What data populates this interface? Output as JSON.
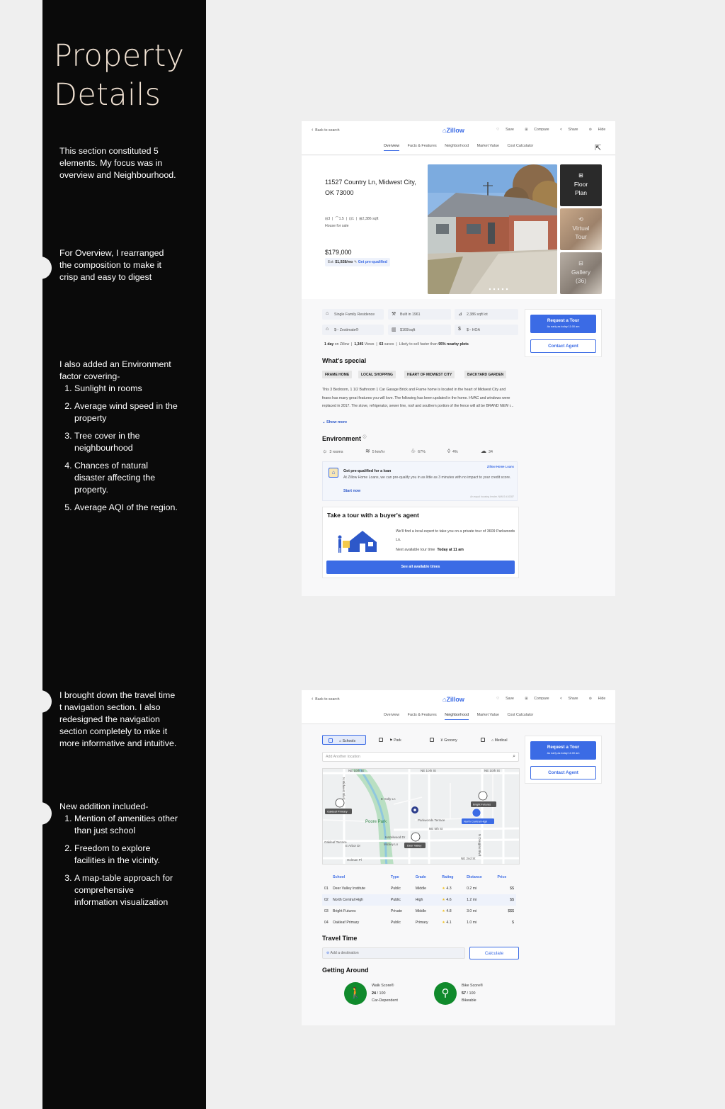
{
  "sidebar": {
    "title": "Property Details",
    "note1": "This section constituted 5 elements. My focus was in overview and Neighbourhood.",
    "note2": "For Overview, I rearranged the composition to make it crisp and easy to digest",
    "note3_intro": "I also added an Environment factor covering-",
    "note3_items": [
      "Sunlight in rooms",
      "Average wind speed in the property",
      "Tree cover in the neighbourhood",
      "Chances of natural disaster affecting the property.",
      "Average AQI of the region."
    ],
    "note4": "I brought down the travel time t navigation section. I also redesigned the navigation section completely to mke it more informative and intuitive.",
    "note5_intro": "New addition included-",
    "note5_items": [
      "Mention of amenities other than just school",
      "Freedom to explore facilities in the vicinity.",
      "A map-table approach for comprehensive information visualization"
    ]
  },
  "nav": {
    "back": "Back to search",
    "logo": "Zillow",
    "actions": [
      "Save",
      "Compare",
      "Share",
      "Hide"
    ],
    "more": "•••",
    "tabs": [
      "Overview",
      "Facts & Features",
      "Neighborhood",
      "Market Value",
      "Cost Calculator"
    ]
  },
  "overview": {
    "address": "11527 Country Ln, Midwest City, OK 73000",
    "beds": "3",
    "baths": "1.5",
    "garage": "1",
    "sqft": "2,386 sqft",
    "status": "House for sale",
    "price": "$179,000",
    "est_label": "Est:",
    "est_value": "$1,928/mo",
    "prequal": "Get pre-qualified",
    "thumb1": "Floor Plan",
    "thumb2": "Virtual Tour",
    "thumb3": "Gallery (36)",
    "chips": [
      "Single Family Residence",
      "Built in 1961",
      "2,386 sqft lot",
      "$-- Zestimate®",
      "$169/sqft",
      "$-- HOA"
    ],
    "stat_days": "1 day",
    "stat_days_suffix": "on Zillow",
    "stat_views": "1,345",
    "stat_views_suffix": "Views",
    "stat_saves": "63",
    "stat_saves_suffix": "saves",
    "stat_sell": "Likely to sell faster than",
    "stat_sell_bold": "95% nearby",
    "stat_sell_end": "plots",
    "special_title": "What's special",
    "tags": [
      "FRAME HOME",
      "LOCAL SHOPPING",
      "HEART OF MIDWEST CITY",
      "BACKYARD GARDEN"
    ],
    "description": "This 3 Bedroom, 1 1/2 Bathroom 1 Car Garage Brick and Frame home is located in the heart of Midwest City and feaes has many great features you will love. The following has been updated in the home. HVAC and windows were replaced in 2017. The stove, refrigerator, sewer line, roof and southern portion of the fence will all be BRAND NEW r...",
    "show_more": "Show more",
    "env_title": "Environment",
    "env": [
      "3 rooms",
      "5 km/hr",
      "67%",
      "4%",
      "34"
    ],
    "loan_brand": "Zillow Home Loans",
    "loan_title": "Get pre-qualified for a loan",
    "loan_text": "At Zillow Home Loans, we can pre-qualify you in as little as 3 minutes with no impact to your credit score.",
    "loan_cta": "Start now",
    "loan_fine": "An equal housing lender. NMLS #10287",
    "tour_title": "Take a tour with a buyer's agent",
    "tour_text": "We'll find a local expert to take you on a private tour of 3609 Parkwoods Ln.",
    "tour_next": "Next available tour time",
    "tour_time": "Today at 11 am",
    "tour_btn": "See all available times"
  },
  "agent": {
    "request": "Request a Tour",
    "request_sub": "As early as today 11:00 am",
    "contact": "Contact Agent"
  },
  "neighborhood": {
    "filters": [
      "Schools",
      "Park",
      "Grocery",
      "Medical"
    ],
    "search_placeholder": "Add Another location",
    "map_streets": [
      "NE 10th St",
      "NE 10th St",
      "NE 10th St",
      "N Midwest Blvd",
      "Parkwoods Terrace",
      "Poore Park",
      "N Douglas Blvd",
      "Hazelwood Dr",
      "Mickey Ln",
      "Holman Pl",
      "NE 2nd St",
      "NE 5th St",
      "E Holly Ln",
      "Oakleaf Terrace",
      "E Arbor Dr"
    ],
    "map_labels": [
      "Oakleaf Primary",
      "Bright Futures",
      "North Central High",
      "Deer Valley"
    ],
    "table_headers": [
      "School",
      "Type",
      "Grade",
      "Rating",
      "Distance",
      "Price"
    ],
    "table_rows": [
      [
        "01",
        "Deer Valley Institute",
        "Public",
        "Middle",
        "4.3",
        "0.2 mi",
        "$$"
      ],
      [
        "02",
        "North Central High",
        "Public",
        "High",
        "4.6",
        "1.2 mi",
        "$$"
      ],
      [
        "03",
        "Bright Futures",
        "Private",
        "Middle",
        "4.8",
        "3.0 mi",
        "$$$"
      ],
      [
        "04",
        "Oakleaf Primary",
        "Public",
        "Primary",
        "4.1",
        "1.0 mi",
        "$"
      ]
    ],
    "travel_title": "Travel Time",
    "dest_placeholder": "Add a destination",
    "calculate": "Calculate",
    "getting_title": "Getting Around",
    "walk_label": "Walk Score®",
    "walk_value": "24",
    "walk_max": "/ 100",
    "walk_desc": "Car-Dependent",
    "bike_label": "Bike Score®",
    "bike_value": "57",
    "bike_max": "/ 100",
    "bike_desc": "Bikeable"
  },
  "colors": {
    "accent": "#3b6be5",
    "sidebar": "#0a0a0a",
    "score_green": "#108a2c",
    "title": "#f1e2d3"
  },
  "icons": [
    "chevron-left-icon",
    "heart-icon",
    "compare-icon",
    "share-icon",
    "hide-icon",
    "home-icon",
    "hammer-icon",
    "ruler-icon",
    "sun-icon",
    "wind-icon",
    "tree-icon",
    "drop-icon",
    "cloud-icon",
    "search-icon",
    "pin-icon",
    "walk-icon",
    "bike-icon"
  ]
}
